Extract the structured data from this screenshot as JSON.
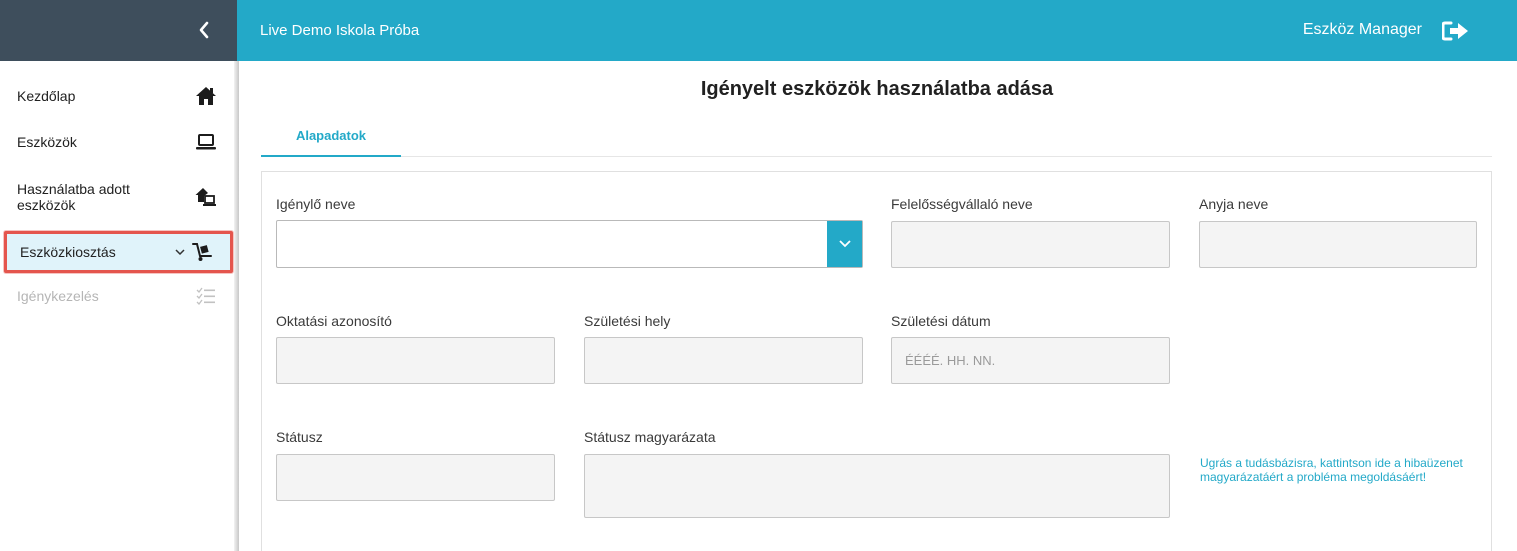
{
  "header": {
    "school_name": "Live Demo Iskola Próba",
    "user_name": "Eszköz Manager"
  },
  "sidebar": {
    "items": [
      {
        "label": "Kezdőlap",
        "icon": "home-icon"
      },
      {
        "label": "Eszközök",
        "icon": "laptop-icon"
      },
      {
        "label": "Használatba adott eszközök",
        "icon": "house-device-icon"
      },
      {
        "label": "Eszközkiosztás",
        "icon": "hand-truck-icon",
        "active": true
      },
      {
        "label": "Igénykezelés",
        "icon": "checklist-icon",
        "disabled": true
      }
    ]
  },
  "main": {
    "title": "Igényelt eszközök használatba adása",
    "tabs": [
      {
        "label": "Alapadatok"
      }
    ],
    "form": {
      "requester_label": "Igénylő neve",
      "guarantor_label": "Felelősségvállaló neve",
      "mother_label": "Anyja neve",
      "edu_id_label": "Oktatási azonosító",
      "birthplace_label": "Születési hely",
      "birthdate_label": "Születési dátum",
      "birthdate_placeholder": "ÉÉÉÉ. HH. NN.",
      "status_label": "Státusz",
      "status_desc_label": "Státusz magyarázata"
    },
    "help_link": "Ugrás a tudásbázisra, kattintson ide a hibaüzenet magyarázatáért a probléma megoldásáért!"
  },
  "colors": {
    "header": "#23a9c8",
    "sidebar_top": "#3e4e5c",
    "active_bg": "#e0f3fa",
    "highlight": "#e4554d"
  }
}
